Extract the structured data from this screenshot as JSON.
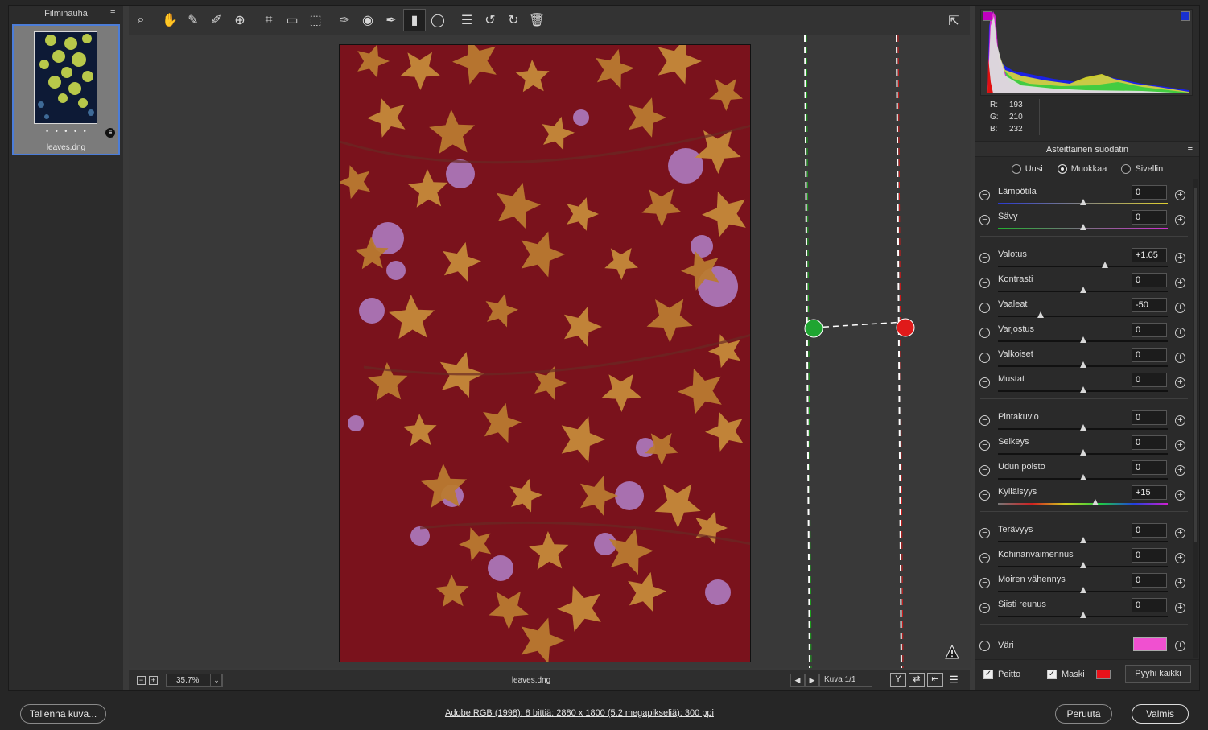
{
  "filmstrip": {
    "title": "Filminauha",
    "thumb_name": "leaves.dng",
    "rating_dots": "• • • • •"
  },
  "toolbar": {
    "tools": [
      "zoom-tool-icon",
      "hand-tool-icon",
      "white-balance-tool-icon",
      "color-sampler-tool-icon",
      "targeted-adjustment-tool-icon",
      "crop-tool-icon",
      "straighten-tool-icon",
      "transform-tool-icon",
      "spot-removal-tool-icon",
      "red-eye-tool-icon",
      "adjustment-brush-icon",
      "graduated-filter-icon",
      "radial-filter-icon",
      "preferences-icon",
      "rotate-left-icon",
      "rotate-right-icon",
      "delete-icon"
    ],
    "active_tool": "graduated-filter-icon",
    "fullscreen_icon": "open-fullscreen-icon"
  },
  "canvas": {
    "filename": "leaves.dng",
    "zoom": "35.7%",
    "counter": "Kuva 1/1",
    "view_buttons": [
      "Y",
      "⇄",
      "⇤"
    ]
  },
  "histogram": {
    "r_label": "R:",
    "r": "193",
    "g_label": "G:",
    "g": "210",
    "b_label": "B:",
    "b": "232"
  },
  "panel": {
    "title": "Asteittainen suodatin",
    "modes": [
      {
        "label": "Uusi",
        "selected": false
      },
      {
        "label": "Muokkaa",
        "selected": true
      },
      {
        "label": "Sivellin",
        "selected": false
      }
    ],
    "sliders": [
      {
        "label": "Lämpötila",
        "value": "0",
        "pos": 0.5,
        "group": 0
      },
      {
        "label": "Sävy",
        "value": "0",
        "pos": 0.5,
        "group": 0
      },
      {
        "label": "Valotus",
        "value": "+1.05",
        "pos": 0.63,
        "group": 1
      },
      {
        "label": "Kontrasti",
        "value": "0",
        "pos": 0.5,
        "group": 1
      },
      {
        "label": "Vaaleat",
        "value": "-50",
        "pos": 0.25,
        "group": 1
      },
      {
        "label": "Varjostus",
        "value": "0",
        "pos": 0.5,
        "group": 1
      },
      {
        "label": "Valkoiset",
        "value": "0",
        "pos": 0.5,
        "group": 1
      },
      {
        "label": "Mustat",
        "value": "0",
        "pos": 0.5,
        "group": 1
      },
      {
        "label": "Pintakuvio",
        "value": "0",
        "pos": 0.5,
        "group": 2
      },
      {
        "label": "Selkeys",
        "value": "0",
        "pos": 0.5,
        "group": 2
      },
      {
        "label": "Udun poisto",
        "value": "0",
        "pos": 0.5,
        "group": 2
      },
      {
        "label": "Kylläisyys",
        "value": "+15",
        "pos": 0.575,
        "group": 2
      },
      {
        "label": "Terävyys",
        "value": "0",
        "pos": 0.5,
        "group": 3
      },
      {
        "label": "Kohinanvaimennus",
        "value": "0",
        "pos": 0.5,
        "group": 3
      },
      {
        "label": "Moiren vähennys",
        "value": "0",
        "pos": 0.5,
        "group": 3
      },
      {
        "label": "Siisti reunus",
        "value": "0",
        "pos": 0.5,
        "group": 3
      }
    ],
    "color_label": "Väri",
    "color_value": "#f050d0",
    "overlay_label": "Peitto",
    "mask_label": "Maski",
    "mask_color": "#e8121a",
    "clear_all": "Pyyhi kaikki"
  },
  "bottom": {
    "save": "Tallenna kuva...",
    "info": "Adobe RGB (1998); 8 bittiä; 2880 x 1800 (5.2 megapikseliä); 300 ppi",
    "cancel": "Peruuta",
    "done": "Valmis"
  }
}
